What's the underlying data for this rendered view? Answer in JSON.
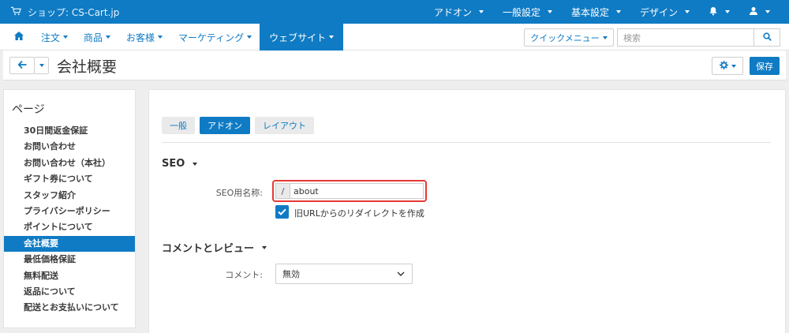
{
  "topbar": {
    "store_label": "ショップ: CS-Cart.jp",
    "menus": [
      "アドオン",
      "一般設定",
      "基本設定",
      "デザイン"
    ]
  },
  "navbar": {
    "items": [
      "注文",
      "商品",
      "お客様",
      "マーケティング",
      "ウェブサイト"
    ],
    "active_item": "ウェブサイト",
    "quick_menu_label": "クイックメニュー",
    "search_placeholder": "検索"
  },
  "titlebar": {
    "page_title": "会社概要",
    "save_label": "保存"
  },
  "sidebar": {
    "title": "ページ",
    "items": [
      "30日間返金保証",
      "お問い合わせ",
      "お問い合わせ（本社）",
      "ギフト券について",
      "スタッフ紹介",
      "プライバシーポリシー",
      "ポイントについて",
      "会社概要",
      "最低価格保証",
      "無料配送",
      "返品について",
      "配送とお支払いについて"
    ],
    "active_index": 7
  },
  "main": {
    "tabs": [
      "一般",
      "アドオン",
      "レイアウト"
    ],
    "active_tab": "アドオン",
    "seo": {
      "section_title": "SEO",
      "field_label": "SEO用名称:",
      "prefix": "/",
      "value": "about",
      "redirect_checkbox_label": "旧URLからのリダイレクトを作成",
      "redirect_checked": true
    },
    "comments": {
      "section_title": "コメントとレビュー",
      "field_label": "コメント:",
      "selected_value": "無効"
    }
  },
  "colors": {
    "accent": "#0f7bc4",
    "highlight": "#e53935"
  }
}
